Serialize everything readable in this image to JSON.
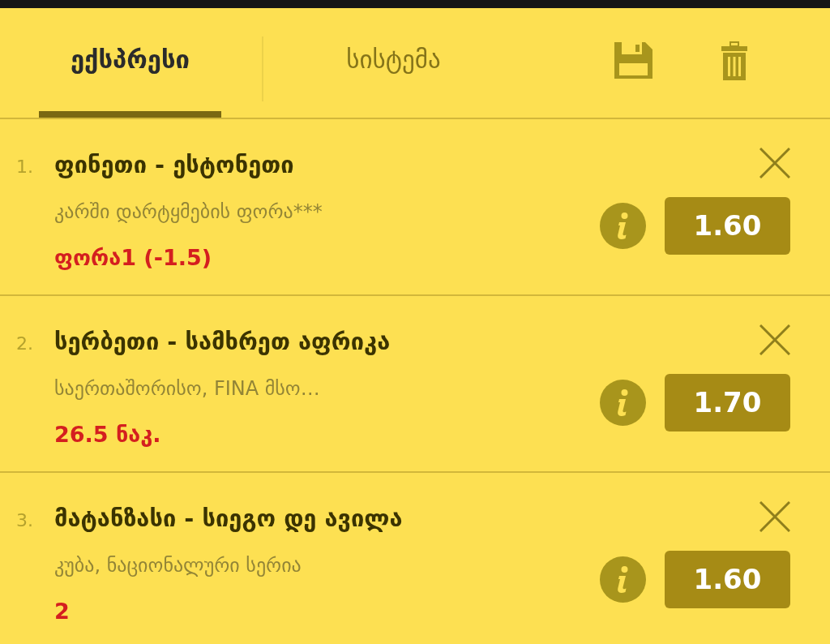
{
  "tabs": [
    {
      "label": "ექსპრესი",
      "selected": true
    },
    {
      "label": "სისტემა",
      "selected": false
    }
  ],
  "bets": [
    {
      "number": "1.",
      "match": "ფინეთი - ესტონეთი",
      "market": "კარში დარტყმების ფორა***",
      "selection": "ფორა1 (-1.5)",
      "odds": "1.60"
    },
    {
      "number": "2.",
      "match": "სერბეთი - სამხრეთ აფრიკა",
      "market": "საერთაშორისო, FINA მსო…",
      "selection": "26.5 ნაკ.",
      "odds": "1.70"
    },
    {
      "number": "3.",
      "match": "მატანზასი - სიეგო დე ავილა",
      "market": "კუბა, ნაციონალური სერია",
      "selection": "2",
      "odds": "1.60"
    }
  ]
}
